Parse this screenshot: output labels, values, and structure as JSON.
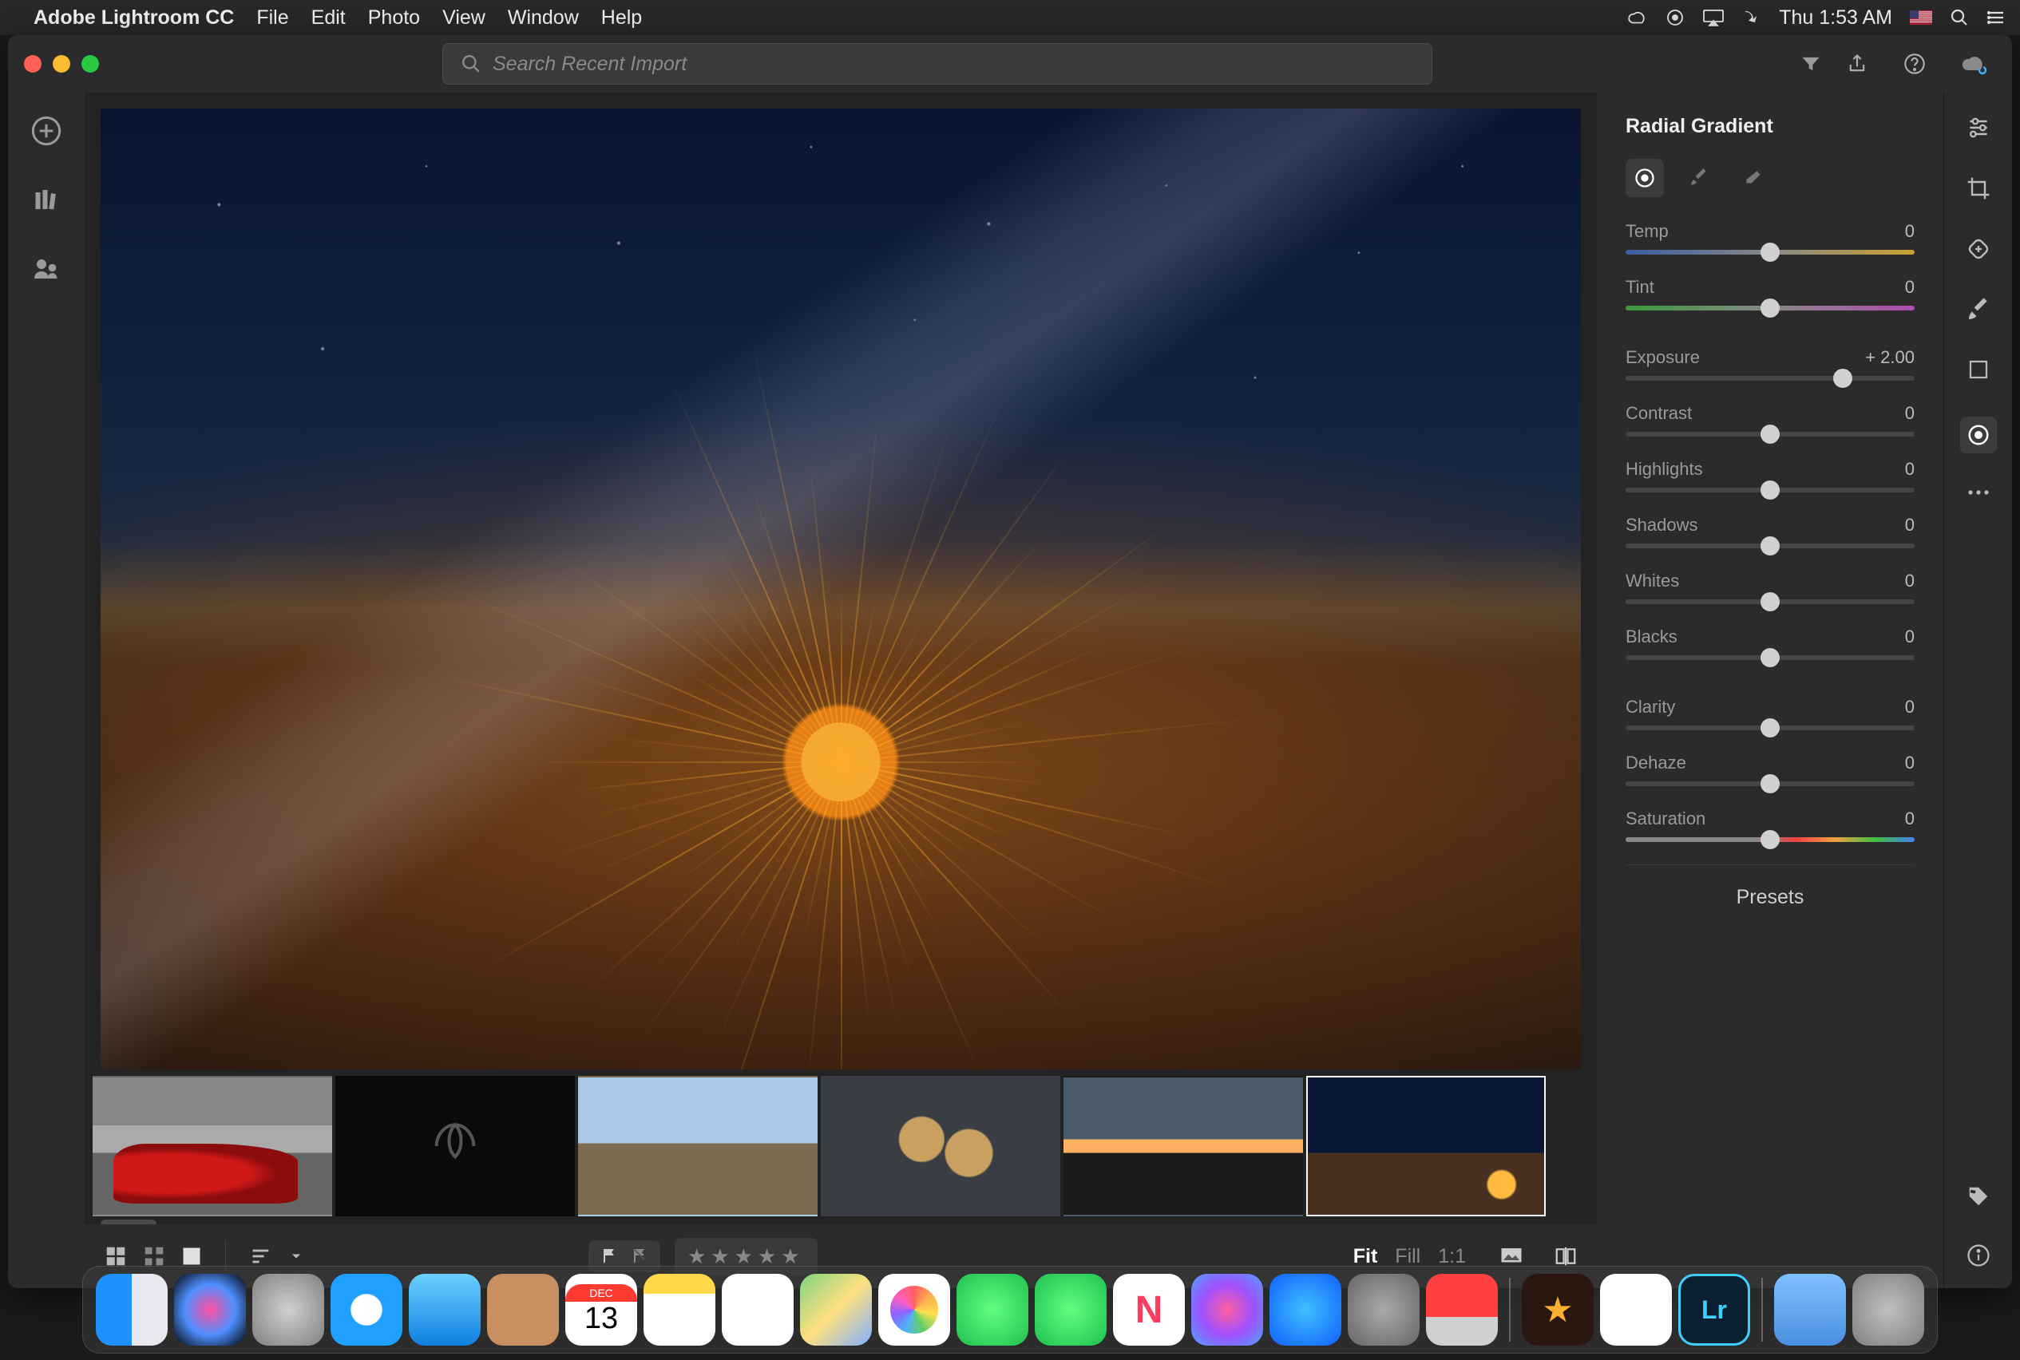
{
  "menubar": {
    "app_name": "Adobe Lightroom CC",
    "items": [
      "File",
      "Edit",
      "Photo",
      "View",
      "Window",
      "Help"
    ],
    "clock": "Thu 1:53 AM"
  },
  "search": {
    "placeholder": "Search Recent Import"
  },
  "panel": {
    "title": "Radial Gradient",
    "sliders": [
      {
        "key": "temp",
        "label": "Temp",
        "value": "0",
        "pos": 50,
        "track": "temp"
      },
      {
        "key": "tint",
        "label": "Tint",
        "value": "0",
        "pos": 50,
        "track": "tint"
      },
      {
        "key": "exposure",
        "label": "Exposure",
        "value": "+ 2.00",
        "pos": 75,
        "track": "plain"
      },
      {
        "key": "contrast",
        "label": "Contrast",
        "value": "0",
        "pos": 50,
        "track": "plain"
      },
      {
        "key": "highlights",
        "label": "Highlights",
        "value": "0",
        "pos": 50,
        "track": "plain"
      },
      {
        "key": "shadows",
        "label": "Shadows",
        "value": "0",
        "pos": 50,
        "track": "plain"
      },
      {
        "key": "whites",
        "label": "Whites",
        "value": "0",
        "pos": 50,
        "track": "plain"
      },
      {
        "key": "blacks",
        "label": "Blacks",
        "value": "0",
        "pos": 50,
        "track": "plain"
      },
      {
        "key": "clarity",
        "label": "Clarity",
        "value": "0",
        "pos": 50,
        "track": "plain"
      },
      {
        "key": "dehaze",
        "label": "Dehaze",
        "value": "0",
        "pos": 50,
        "track": "plain"
      },
      {
        "key": "saturation",
        "label": "Saturation",
        "value": "0",
        "pos": 50,
        "track": "sat"
      }
    ],
    "presets_label": "Presets"
  },
  "zoom": {
    "fit": "Fit",
    "fill": "Fill",
    "one": "1:1"
  },
  "calendar": {
    "month": "DEC",
    "day": "13"
  },
  "dock": {
    "news": "N",
    "imovie": "★",
    "lr": "Lr"
  }
}
